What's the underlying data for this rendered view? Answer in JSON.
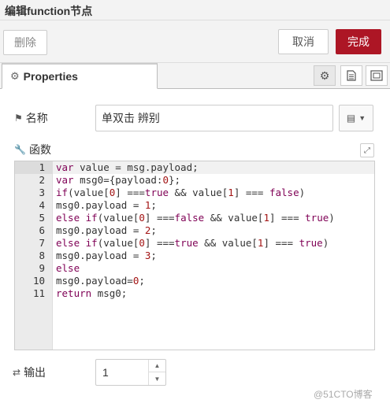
{
  "window": {
    "title": "编辑function节点"
  },
  "toolbar": {
    "delete_label": "删除",
    "cancel_label": "取消",
    "done_label": "完成",
    "done_color": "#ad1625"
  },
  "tabs": {
    "properties_label": "Properties"
  },
  "form": {
    "name_label": "名称",
    "name_value": "单双击 辨别",
    "function_label": "函数",
    "outputs_label": "输出",
    "outputs_value": "1"
  },
  "editor": {
    "lines": [
      {
        "n": "1",
        "tokens": [
          [
            "kw",
            "var"
          ],
          [
            "t",
            " value = msg.payload;"
          ]
        ]
      },
      {
        "n": "2",
        "tokens": [
          [
            "kw",
            "var"
          ],
          [
            "t",
            " msg0={payload:"
          ],
          [
            "num",
            "0"
          ],
          [
            "t",
            "};"
          ]
        ]
      },
      {
        "n": "3",
        "tokens": [
          [
            "kw",
            "if"
          ],
          [
            "t",
            "(value["
          ],
          [
            "num",
            "0"
          ],
          [
            "t",
            "] ==="
          ],
          [
            "kw",
            "true"
          ],
          [
            "t",
            " && value["
          ],
          [
            "num",
            "1"
          ],
          [
            "t",
            "] === "
          ],
          [
            "kw",
            "false"
          ],
          [
            "t",
            ")"
          ]
        ]
      },
      {
        "n": "4",
        "tokens": [
          [
            "t",
            "msg0.payload = "
          ],
          [
            "num",
            "1"
          ],
          [
            "t",
            ";"
          ]
        ]
      },
      {
        "n": "5",
        "tokens": [
          [
            "kw",
            "else if"
          ],
          [
            "t",
            "(value["
          ],
          [
            "num",
            "0"
          ],
          [
            "t",
            "] ==="
          ],
          [
            "kw",
            "false"
          ],
          [
            "t",
            " && value["
          ],
          [
            "num",
            "1"
          ],
          [
            "t",
            "] === "
          ],
          [
            "kw",
            "true"
          ],
          [
            "t",
            ")"
          ]
        ]
      },
      {
        "n": "6",
        "tokens": [
          [
            "t",
            "msg0.payload = "
          ],
          [
            "num",
            "2"
          ],
          [
            "t",
            ";"
          ]
        ]
      },
      {
        "n": "7",
        "tokens": [
          [
            "kw",
            "else if"
          ],
          [
            "t",
            "(value["
          ],
          [
            "num",
            "0"
          ],
          [
            "t",
            "] ==="
          ],
          [
            "kw",
            "true"
          ],
          [
            "t",
            " && value["
          ],
          [
            "num",
            "1"
          ],
          [
            "t",
            "] === "
          ],
          [
            "kw",
            "true"
          ],
          [
            "t",
            ")"
          ]
        ]
      },
      {
        "n": "8",
        "tokens": [
          [
            "t",
            "msg0.payload = "
          ],
          [
            "num",
            "3"
          ],
          [
            "t",
            ";"
          ]
        ]
      },
      {
        "n": "9",
        "tokens": [
          [
            "kw",
            "else"
          ]
        ]
      },
      {
        "n": "10",
        "tokens": [
          [
            "t",
            "msg0.payload="
          ],
          [
            "num",
            "0"
          ],
          [
            "t",
            ";"
          ]
        ]
      },
      {
        "n": "11",
        "tokens": [
          [
            "kw",
            "return"
          ],
          [
            "t",
            " msg0;"
          ]
        ]
      }
    ],
    "colors": {
      "keyword": "#7f0055",
      "number": "#a31515",
      "text": "#333333"
    }
  },
  "icons": {
    "properties_tab": "gear-icon",
    "description_tab": "document-icon",
    "appearance_tab": "layout-icon",
    "name_tag": "tag-icon",
    "library": "book-icon",
    "function": "wrench-icon",
    "outputs": "shuffle-icon",
    "expand": "expand-icon"
  },
  "watermark": "@51CTO博客"
}
